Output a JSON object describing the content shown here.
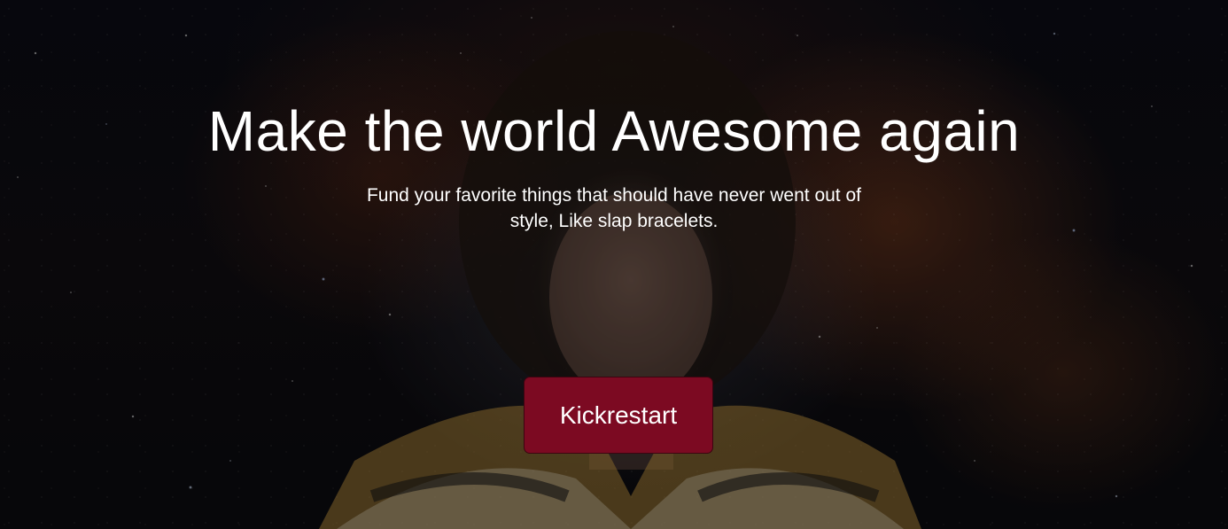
{
  "hero": {
    "headline": "Make the world Awesome again",
    "subheadline": "Fund your favorite things that should have never went out of style,  Like slap bracelets.",
    "cta_label": "Kickrestart"
  },
  "colors": {
    "cta_background": "#7c0a22",
    "text": "#ffffff",
    "background": "#07080d"
  }
}
